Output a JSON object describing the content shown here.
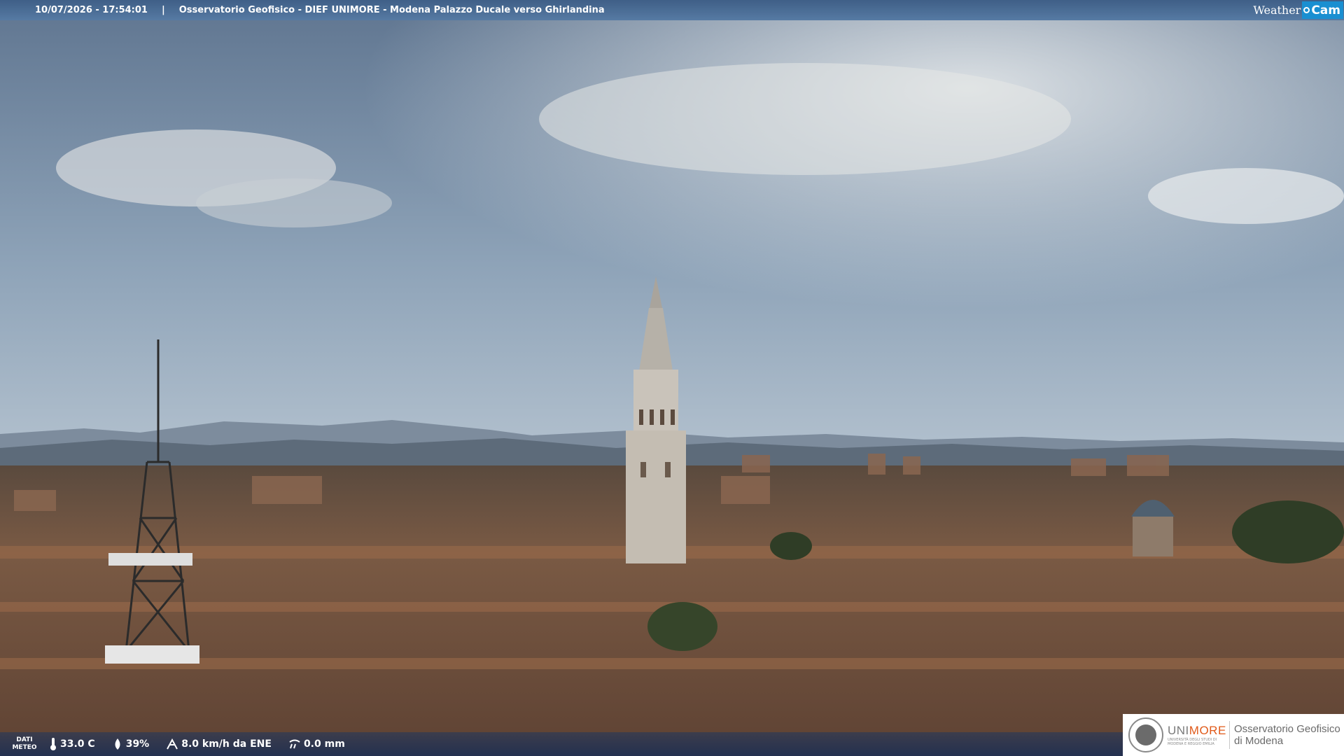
{
  "topbar": {
    "timestamp": "10/07/2026 - 17:54:01",
    "separator": "|",
    "title": "Osservatorio Geofisico - DIEF UNIMORE - Modena Palazzo Ducale verso Ghirlandina",
    "brand_weather": "Weather",
    "brand_cam": "Cam"
  },
  "meteo": {
    "label_line1": "DATI",
    "label_line2": "METEO",
    "temperature": "33.0 C",
    "humidity": "39%",
    "wind": "8.0 km/h da ENE",
    "rain": "0.0 mm",
    "icons": [
      "thermometer-icon",
      "droplet-icon",
      "wind-icon",
      "rain-gauge-icon"
    ]
  },
  "logo": {
    "university_part1": "UNI",
    "university_part2": "MORE",
    "university_sub": "UNIVERSITÀ DEGLI STUDI DI MODENA E REGGIO EMILIA",
    "observatory_line1": "Osservatorio Geofisico",
    "observatory_line2": "di Modena"
  },
  "colors": {
    "topbar": "#4a6c95",
    "brand_cam": "#1a8fd1",
    "unimore_accent": "#e05a1a"
  }
}
